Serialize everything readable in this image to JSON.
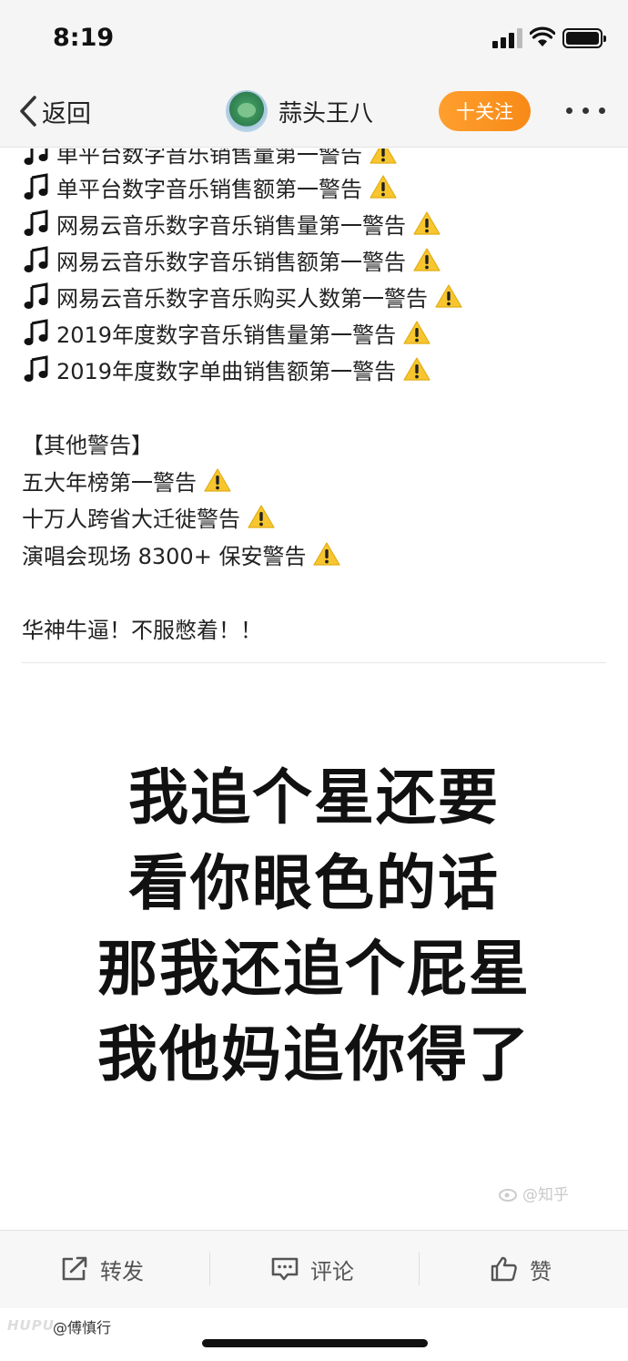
{
  "status_bar": {
    "time": "8:19"
  },
  "nav": {
    "back_label": "返回",
    "title": "蒜头王八",
    "follow_label": "十关注"
  },
  "post": {
    "lines": [
      {
        "text": "单平台数字音乐销售量第一警告",
        "note": true,
        "warn": true
      },
      {
        "text": "单平台数字音乐销售额第一警告",
        "note": true,
        "warn": true
      },
      {
        "text": "网易云音乐数字音乐销售量第一警告",
        "note": true,
        "warn": true
      },
      {
        "text": "网易云音乐数字音乐销售额第一警告",
        "note": true,
        "warn": true
      },
      {
        "text": "网易云音乐数字音乐购买人数第一警告",
        "note": true,
        "warn": true
      },
      {
        "text": "2019年度数字音乐销售量第一警告",
        "note": true,
        "warn": true
      },
      {
        "text": "2019年度数字单曲销售额第一警告",
        "note": true,
        "warn": true
      },
      {
        "text": "【其他警告】",
        "note": false,
        "warn": false
      },
      {
        "text": "五大年榜第一警告",
        "note": false,
        "warn": true
      },
      {
        "text": "十万人跨省大迁徙警告",
        "note": false,
        "warn": true
      },
      {
        "text": "演唱会现场 8300+ 保安警告",
        "note": false,
        "warn": true
      },
      {
        "text": "华神牛逼！不服憋着！！",
        "note": false,
        "warn": false
      }
    ]
  },
  "meme": {
    "lines": [
      "我追个星还要",
      "看你眼色的话",
      "那我还追个屁星",
      "我他妈追你得了"
    ],
    "watermark": "@知乎"
  },
  "actions": {
    "repost": "转发",
    "comment": "评论",
    "like": "赞"
  },
  "footer": {
    "source": "HUPU",
    "user": "@傅慎行"
  },
  "colors": {
    "follow_button": "#f78a17",
    "warning": "#f7c62f",
    "background": "#ffffff",
    "bar_background": "#f5f5f5"
  }
}
